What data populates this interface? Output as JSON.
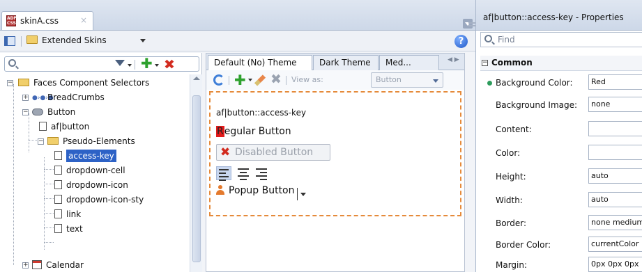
{
  "editor": {
    "tab_title": "skinA.css",
    "tab_close": "×",
    "file_icon_text": "ADF CSS"
  },
  "toolbar": {
    "skins_label": "Extended Skins",
    "help_label": "?"
  },
  "tree": {
    "search_placeholder": "",
    "items": [
      {
        "label": "Faces Component Selectors"
      },
      {
        "label": "BreadCrumbs"
      },
      {
        "label": "Button"
      },
      {
        "label": "af|button"
      },
      {
        "label": "Pseudo-Elements"
      },
      {
        "label": "access-key"
      },
      {
        "label": "dropdown-cell"
      },
      {
        "label": "dropdown-icon"
      },
      {
        "label": "dropdown-icon-sty"
      },
      {
        "label": "link"
      },
      {
        "label": "text"
      },
      {
        "label": "Calendar"
      }
    ]
  },
  "preview": {
    "tabs": [
      {
        "label": "Default (No) Theme"
      },
      {
        "label": "Dark Theme"
      },
      {
        "label": "Med..."
      }
    ],
    "view_as_label": "View as:",
    "view_as_value": "Button",
    "selector_label": "af|button::access-key",
    "regular_button_key": "R",
    "regular_button_rest": "egular Button",
    "disabled_button": "Disabled Button",
    "popup_button": "Popup Button"
  },
  "properties": {
    "title": "af|button::access-key - Properties",
    "find_placeholder": "Find",
    "group_label": "Common",
    "rows": [
      {
        "label": "Background Color:",
        "value": "Red"
      },
      {
        "label": "Background Image:",
        "value": "none"
      },
      {
        "label": "Content:",
        "value": ""
      },
      {
        "label": "Color:",
        "value": ""
      },
      {
        "label": "Height:",
        "value": "auto"
      },
      {
        "label": "Width:",
        "value": "auto"
      },
      {
        "label": "Border:",
        "value": "none medium"
      },
      {
        "label": "Border Color:",
        "value": "currentColor"
      },
      {
        "label": "Margin:",
        "value": "0px 0px 0px"
      }
    ]
  },
  "colors": {
    "accent": "#2d62c6",
    "preview_border": "#e58a3a",
    "access_key_bg": "#e31b1b"
  }
}
